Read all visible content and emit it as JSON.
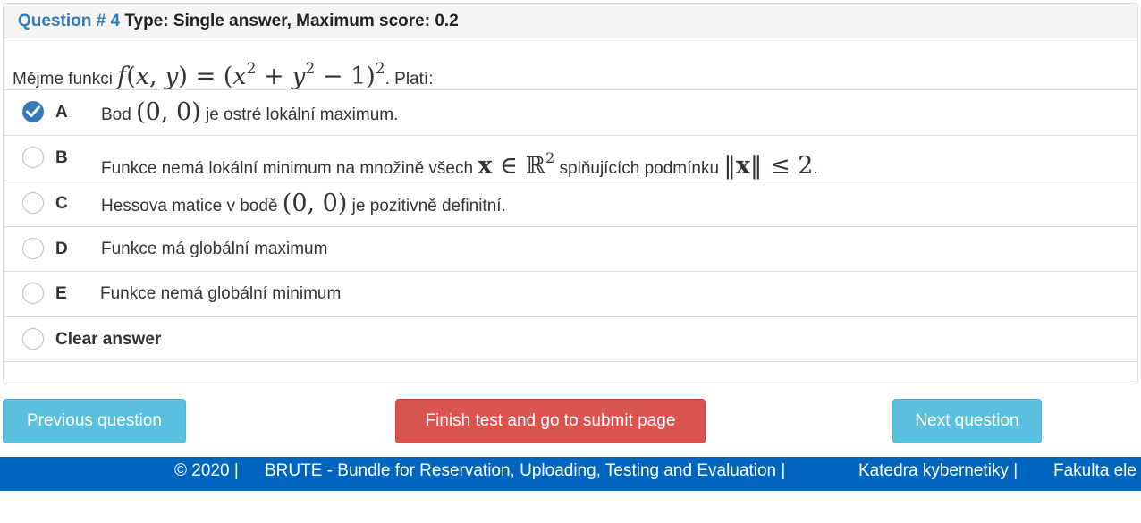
{
  "question": {
    "number_label": "Question # 4",
    "type_label": "Type: Single answer, Maximum score: 0.2",
    "prompt_prefix": "Mějme funkci",
    "prompt_formula": "f(x, y) = (x² + y² − 1)²",
    "prompt_suffix": ". Platí:"
  },
  "options": [
    {
      "letter": "A",
      "checked": true,
      "text_before": "Bod",
      "math": "(0, 0)",
      "text_after": "je ostré lokální maximum."
    },
    {
      "letter": "B",
      "checked": false,
      "text_before": "Funkce nemá lokální minimum na množině všech",
      "math1": "x ∈ ℝ²",
      "text_middle": "splňujících podmínku",
      "math2": "‖x‖ ≤ 2",
      "text_after": "."
    },
    {
      "letter": "C",
      "checked": false,
      "text_before": "Hessova matice v bodě",
      "math": "(0, 0)",
      "text_after": "je pozitivně definitní."
    },
    {
      "letter": "D",
      "checked": false,
      "text": "Funkce má globální maximum"
    },
    {
      "letter": "E",
      "checked": false,
      "text": "Funkce nemá globální minimum"
    }
  ],
  "clear_answer_label": "Clear answer",
  "buttons": {
    "previous": "Previous question",
    "finish": "Finish test and go to submit page",
    "next": "Next question"
  },
  "footer": {
    "copyright": "© 2020 |",
    "brute": "BRUTE - Bundle for Reservation, Uploading, Testing and Evaluation |",
    "department": "Katedra kybernetiky |",
    "faculty": "Fakulta ele"
  },
  "colors": {
    "primary": "#337ab7",
    "info": "#5bc0de",
    "danger": "#d9534f",
    "footer": "#0065bd"
  },
  "icons": {
    "selected_radio": "check-circle-icon",
    "unselected_radio": "radio-empty-icon"
  }
}
